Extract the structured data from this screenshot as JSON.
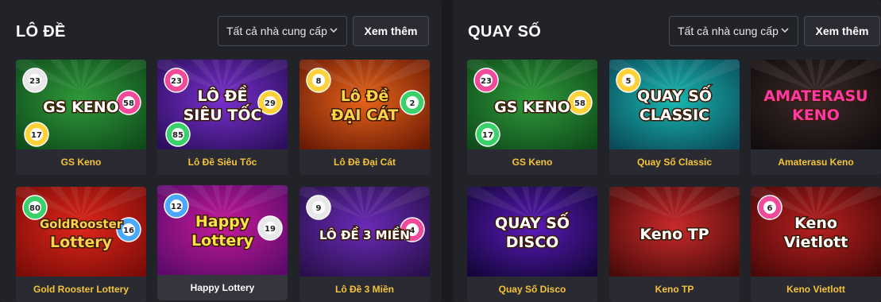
{
  "sections": [
    {
      "title": "LÔ ĐỀ",
      "provider_filter": "Tất cả nhà cung cấp",
      "more_label": "Xem thêm",
      "games": [
        {
          "name": "GS Keno",
          "art_text": [
            "GS KENO"
          ],
          "numbers": [
            "23",
            "58",
            "17"
          ],
          "bg": "#2e9a3a",
          "bg2": "#0f4a1a",
          "title_color": "#ffffff"
        },
        {
          "name": "Lô Đề Siêu Tốc",
          "art_text": [
            "LÔ ĐỀ",
            "SIÊU TỐC"
          ],
          "numbers": [
            "23",
            "29",
            "85"
          ],
          "bg": "#7a2fd0",
          "bg2": "#2a0f5a",
          "title_color": "#ffffff"
        },
        {
          "name": "Lô Đề Đại Cát",
          "art_text": [
            "Lô Đề",
            "ĐẠI CÁT"
          ],
          "numbers": [
            "8",
            "2"
          ],
          "bg": "#e8641a",
          "bg2": "#6a1a05",
          "title_color": "#ffd24a"
        },
        {
          "name": "Gold Rooster Lottery",
          "art_text": [
            "GoldRooster",
            "Lottery"
          ],
          "numbers": [
            "80",
            "16"
          ],
          "bg": "#e0261a",
          "bg2": "#7a0c08",
          "title_color": "#ffd24a"
        },
        {
          "name": "Happy Lottery",
          "art_text": [
            "Happy",
            "Lottery"
          ],
          "numbers": [
            "12",
            "19"
          ],
          "bg": "#c41a9a",
          "bg2": "#5a0a6a",
          "title_color": "#ffe14a"
        },
        {
          "name": "Lô Đề 3 Miền",
          "art_text": [
            "LÔ ĐỀ 3 MIỀN"
          ],
          "numbers": [
            "9",
            "4"
          ],
          "bg": "#6a2ab8",
          "bg2": "#28104a",
          "title_color": "#ffffff"
        }
      ]
    },
    {
      "title": "QUAY SỐ",
      "provider_filter": "Tất cả nhà cung cấp",
      "more_label": "Xem thêm",
      "games": [
        {
          "name": "GS Keno",
          "art_text": [
            "GS KENO"
          ],
          "numbers": [
            "23",
            "58",
            "17"
          ],
          "bg": "#2e9a3a",
          "bg2": "#0f4a1a",
          "title_color": "#ffffff"
        },
        {
          "name": "Quay Số Classic",
          "art_text": [
            "QUAY SỐ",
            "CLASSIC"
          ],
          "numbers": [
            "5"
          ],
          "bg": "#19b8b0",
          "bg2": "#0a4a5a",
          "title_color": "#ffffff"
        },
        {
          "name": "Amaterasu Keno",
          "art_text": [
            "AMATERASU",
            "KENO"
          ],
          "numbers": [],
          "bg": "#3a2a2a",
          "bg2": "#120c0c",
          "title_color": "#ff3aa8"
        },
        {
          "name": "Quay Số Disco",
          "art_text": [
            "QUAY SỐ",
            "DISCO"
          ],
          "numbers": [],
          "bg": "#5a1ab8",
          "bg2": "#14063a",
          "title_color": "#ffffff"
        },
        {
          "name": "Keno TP",
          "art_text": [
            "Keno TP"
          ],
          "numbers": [],
          "bg": "#c82a2a",
          "bg2": "#4a0a0a",
          "title_color": "#ffffff"
        },
        {
          "name": "Keno Vietlott",
          "art_text": [
            "Keno",
            "Vietlott"
          ],
          "numbers": [
            "6"
          ],
          "bg": "#b82020",
          "bg2": "#4a0808",
          "title_color": "#ffffff"
        }
      ]
    }
  ],
  "colors": {
    "page_bg": "#1a1b1f",
    "panel_bg": "#222328",
    "card_bg": "#2a2b32",
    "game_name": "#f4c338",
    "border": "#4a4c55"
  }
}
